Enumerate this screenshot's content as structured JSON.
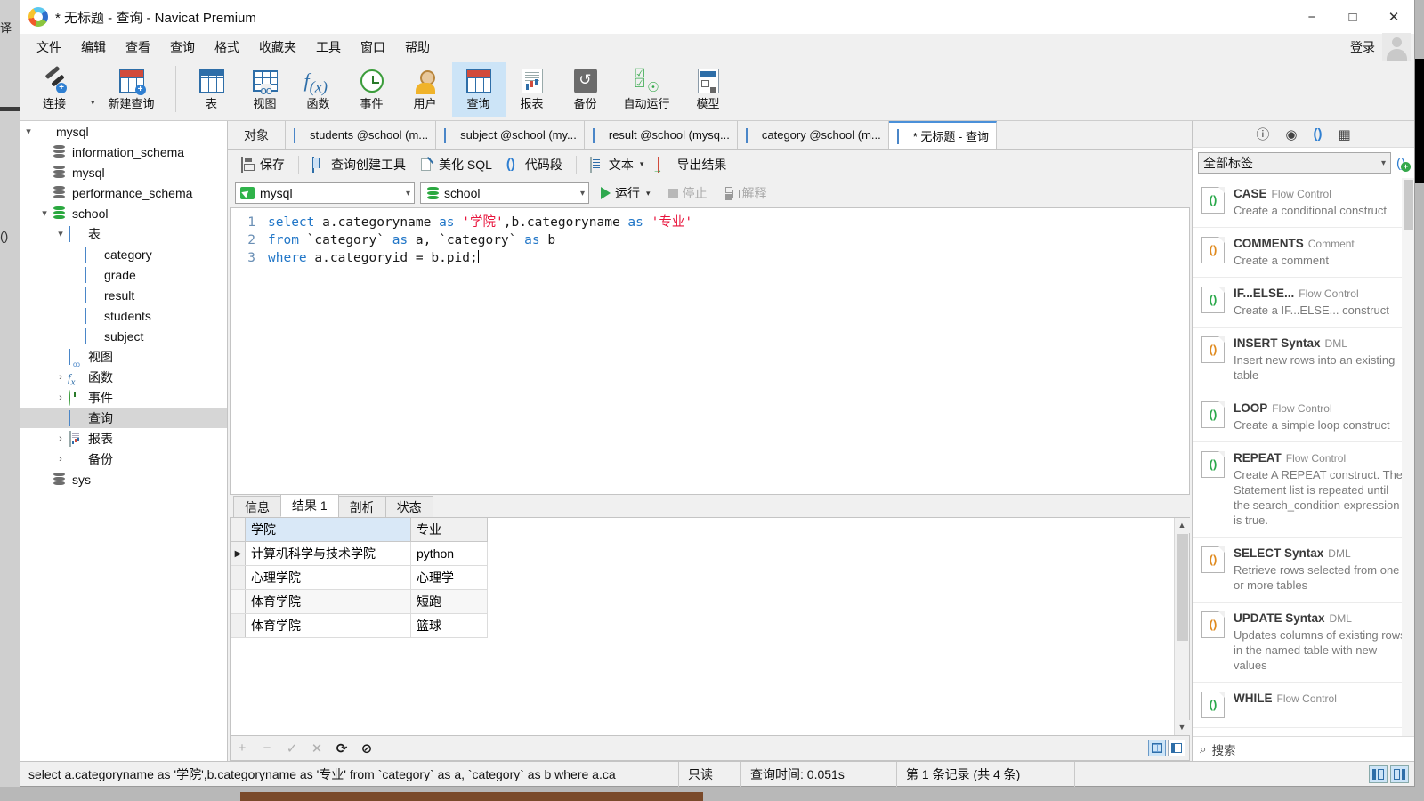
{
  "window": {
    "title": "* 无标题 - 查询 - Navicat Premium",
    "minimize": "−",
    "maximize": "□",
    "close": "✕"
  },
  "menubar": {
    "items": [
      "文件",
      "编辑",
      "查看",
      "查询",
      "格式",
      "收藏夹",
      "工具",
      "窗口",
      "帮助"
    ],
    "login_label": "登录"
  },
  "toolbar": {
    "buttons": [
      {
        "label": "连接",
        "icon": "connection-icon"
      },
      {
        "label": "新建查询",
        "icon": "new-query-icon"
      },
      {
        "label": "表",
        "icon": "table-icon"
      },
      {
        "label": "视图",
        "icon": "view-icon"
      },
      {
        "label": "函数",
        "icon": "function-icon"
      },
      {
        "label": "事件",
        "icon": "event-icon"
      },
      {
        "label": "用户",
        "icon": "user-icon"
      },
      {
        "label": "查询",
        "icon": "query-icon"
      },
      {
        "label": "报表",
        "icon": "report-icon"
      },
      {
        "label": "备份",
        "icon": "backup-icon"
      },
      {
        "label": "自动运行",
        "icon": "automation-icon"
      },
      {
        "label": "模型",
        "icon": "model-icon"
      }
    ],
    "active_index": 7
  },
  "sidebar": {
    "items": [
      {
        "label": "mysql",
        "level": 0,
        "twisty": "▾",
        "icon": "connection-icon",
        "selected": false
      },
      {
        "label": "information_schema",
        "level": 1,
        "twisty": "",
        "icon": "database-icon",
        "selected": false
      },
      {
        "label": "mysql",
        "level": 1,
        "twisty": "",
        "icon": "database-icon",
        "selected": false
      },
      {
        "label": "performance_schema",
        "level": 1,
        "twisty": "",
        "icon": "database-icon",
        "selected": false
      },
      {
        "label": "school",
        "level": 1,
        "twisty": "▾",
        "icon": "database-green-icon",
        "selected": false
      },
      {
        "label": "表",
        "level": 2,
        "twisty": "▾",
        "icon": "tables-folder-icon",
        "selected": false
      },
      {
        "label": "category",
        "level": 3,
        "twisty": "",
        "icon": "table-icon",
        "selected": false
      },
      {
        "label": "grade",
        "level": 3,
        "twisty": "",
        "icon": "table-icon",
        "selected": false
      },
      {
        "label": "result",
        "level": 3,
        "twisty": "",
        "icon": "table-icon",
        "selected": false
      },
      {
        "label": "students",
        "level": 3,
        "twisty": "",
        "icon": "table-icon",
        "selected": false
      },
      {
        "label": "subject",
        "level": 3,
        "twisty": "",
        "icon": "table-icon",
        "selected": false
      },
      {
        "label": "视图",
        "level": 2,
        "twisty": "",
        "icon": "views-icon",
        "selected": false
      },
      {
        "label": "函数",
        "level": 2,
        "twisty": "›",
        "icon": "function-icon",
        "selected": false
      },
      {
        "label": "事件",
        "level": 2,
        "twisty": "›",
        "icon": "event-icon",
        "selected": false
      },
      {
        "label": "查询",
        "level": 2,
        "twisty": "",
        "icon": "query-icon",
        "selected": true
      },
      {
        "label": "报表",
        "level": 2,
        "twisty": "›",
        "icon": "report-icon",
        "selected": false
      },
      {
        "label": "备份",
        "level": 2,
        "twisty": "›",
        "icon": "backup-icon",
        "selected": false
      },
      {
        "label": "sys",
        "level": 1,
        "twisty": "",
        "icon": "database-icon",
        "selected": false
      }
    ]
  },
  "tabs": {
    "object_button": "对象",
    "documents": [
      {
        "label": "students @school (m...",
        "icon": "table-icon",
        "active": false
      },
      {
        "label": "subject @school (my...",
        "icon": "table-icon",
        "active": false
      },
      {
        "label": "result @school (mysq...",
        "icon": "table-icon",
        "active": false
      },
      {
        "label": "category @school (m...",
        "icon": "table-icon",
        "active": false
      },
      {
        "label": "* 无标题 - 查询",
        "icon": "query-icon",
        "active": true
      }
    ]
  },
  "query_toolbar": {
    "save": "保存",
    "query_builder": "查询创建工具",
    "beautify_sql": "美化 SQL",
    "code_snippet": "代码段",
    "text": "文本",
    "export_result": "导出结果"
  },
  "connection_row": {
    "connection": "mysql",
    "database": "school",
    "run": "运行",
    "stop": "停止",
    "explain": "解释"
  },
  "editor": {
    "line_numbers": [
      "1",
      "2",
      "3"
    ],
    "lines": [
      [
        {
          "t": "select ",
          "c": "kw"
        },
        {
          "t": "a.categoryname ",
          "c": "pln"
        },
        {
          "t": "as ",
          "c": "kw"
        },
        {
          "t": "'学院'",
          "c": "str"
        },
        {
          "t": ",b.categoryname ",
          "c": "pln"
        },
        {
          "t": "as ",
          "c": "kw"
        },
        {
          "t": "'专业'",
          "c": "str"
        }
      ],
      [
        {
          "t": "from ",
          "c": "kw"
        },
        {
          "t": "`category` ",
          "c": "pln"
        },
        {
          "t": "as ",
          "c": "kw"
        },
        {
          "t": "a, ",
          "c": "pln"
        },
        {
          "t": "`category` ",
          "c": "pln"
        },
        {
          "t": "as ",
          "c": "kw"
        },
        {
          "t": "b",
          "c": "pln"
        }
      ],
      [
        {
          "t": "where ",
          "c": "kw"
        },
        {
          "t": "a.categoryid = b.pid;",
          "c": "pln"
        }
      ]
    ]
  },
  "results": {
    "tabs": [
      {
        "label": "信息",
        "active": false
      },
      {
        "label": "结果 1",
        "active": true
      },
      {
        "label": "剖析",
        "active": false
      },
      {
        "label": "状态",
        "active": false
      }
    ],
    "columns": [
      "学院",
      "专业"
    ],
    "selected_column_index": 0,
    "rows": [
      {
        "marker": "▶",
        "cells": [
          "计算机科学与技术学院",
          "python"
        ]
      },
      {
        "marker": "",
        "cells": [
          "心理学院",
          "心理学"
        ]
      },
      {
        "marker": "",
        "cells": [
          "体育学院",
          "短跑"
        ]
      },
      {
        "marker": "",
        "cells": [
          "体育学院",
          "篮球"
        ]
      }
    ],
    "footer_icons": [
      "+",
      "−",
      "✓",
      "✕",
      "⟳",
      "⊘"
    ]
  },
  "right_panel": {
    "header_icons": [
      "info-icon",
      "eye-icon",
      "snippet-icon",
      "structure-icon"
    ],
    "filter_value": "全部标签",
    "search_placeholder": "搜索",
    "snippets": [
      {
        "title": "CASE",
        "category": "Flow Control",
        "desc": "Create a conditional construct",
        "color": "green"
      },
      {
        "title": "COMMENTS",
        "category": "Comment",
        "desc": "Create a comment",
        "color": "orange"
      },
      {
        "title": "IF...ELSE...",
        "category": "Flow Control",
        "desc": "Create a IF...ELSE... construct",
        "color": "green"
      },
      {
        "title": "INSERT Syntax",
        "category": "DML",
        "desc": "Insert new rows into an existing table",
        "color": "orange"
      },
      {
        "title": "LOOP",
        "category": "Flow Control",
        "desc": "Create a simple loop construct",
        "color": "green"
      },
      {
        "title": "REPEAT",
        "category": "Flow Control",
        "desc": "Create A REPEAT construct. The Statement list is repeated until the search_condition expression is true.",
        "color": "green"
      },
      {
        "title": "SELECT Syntax",
        "category": "DML",
        "desc": "Retrieve rows selected from one or more tables",
        "color": "orange"
      },
      {
        "title": "UPDATE Syntax",
        "category": "DML",
        "desc": "Updates columns of existing rows in the named table with new values",
        "color": "orange"
      },
      {
        "title": "WHILE",
        "category": "Flow Control",
        "desc": "",
        "color": "green"
      }
    ]
  },
  "statusbar": {
    "sql": "select a.categoryname as '学院',b.categoryname as '专业' from `category` as a, `category` as b where a.ca",
    "readonly": "只读",
    "query_time": "查询时间: 0.051s",
    "record_info": "第 1 条记录 (共 4 条)"
  }
}
